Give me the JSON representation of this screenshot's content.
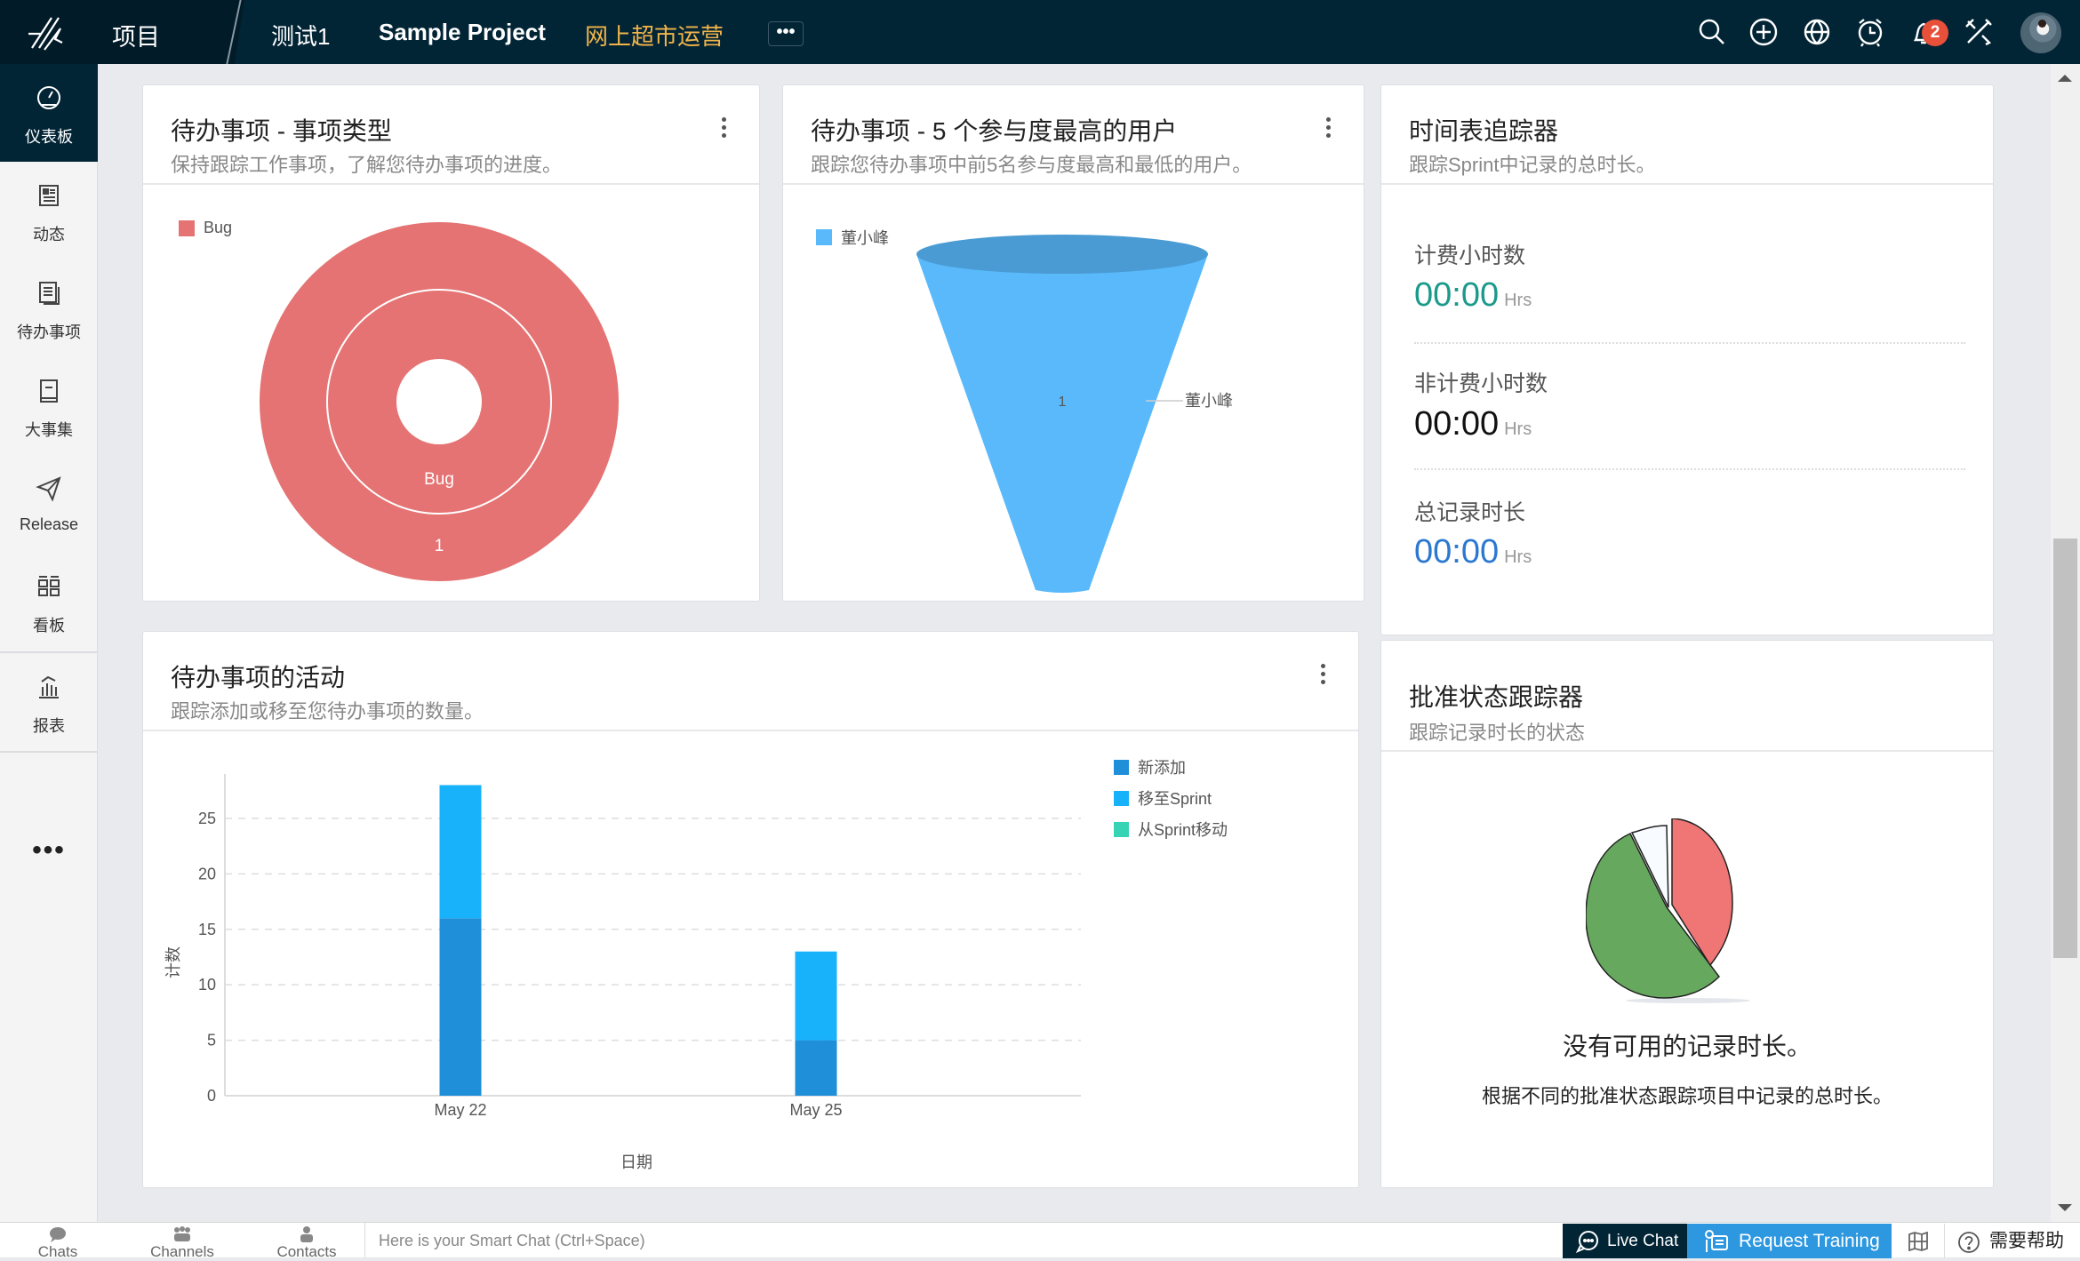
{
  "topbar": {
    "projects_label": "项目",
    "breadcrumbs": [
      "测试1",
      "Sample Project",
      "网上超市运营"
    ],
    "more_label": "•••",
    "notification_count": "2",
    "icons": [
      "search-icon",
      "add-icon",
      "globe-icon",
      "alarm-icon",
      "bell-icon",
      "tools-icon",
      "avatar"
    ]
  },
  "sidebar": {
    "items": [
      {
        "label": "仪表板",
        "icon": "dashboard-icon",
        "active": true
      },
      {
        "label": "动态",
        "icon": "feed-icon"
      },
      {
        "label": "待办事项",
        "icon": "backlog-icon"
      },
      {
        "label": "大事集",
        "icon": "epic-icon"
      },
      {
        "label": "Release",
        "icon": "release-icon"
      },
      {
        "label": "看板",
        "icon": "board-icon"
      },
      {
        "label": "报表",
        "icon": "reports-icon"
      }
    ],
    "more_label": "•••"
  },
  "cards": {
    "item_type": {
      "title": "待办事项 - 事项类型",
      "subtitle": "保持跟踪工作事项，了解您待办事项的进度。",
      "legend": "Bug",
      "inner_label": "Bug",
      "outer_label": "1"
    },
    "top_users": {
      "title": "待办事项 - 5 个参与度最高的用户",
      "subtitle": "跟踪您待办事项中前5名参与度最高和最低的用户。",
      "legend": "董小峰",
      "value_label": "1",
      "callout_label": "董小峰"
    },
    "timesheet": {
      "title": "时间表追踪器",
      "subtitle": "跟踪Sprint中记录的总时长。",
      "rows": [
        {
          "label": "计费小时数",
          "value": "00:00",
          "unit": "Hrs",
          "color": "#1a9a8a"
        },
        {
          "label": "非计费小时数",
          "value": "00:00",
          "unit": "Hrs",
          "color": "#111111"
        },
        {
          "label": "总记录时长",
          "value": "00:00",
          "unit": "Hrs",
          "color": "#2a78d0"
        }
      ]
    },
    "approval": {
      "title": "批准状态跟踪器",
      "subtitle": "跟踪记录时长的状态",
      "empty_title": "没有可用的记录时长。",
      "empty_desc": "根据不同的批准状态跟踪项目中记录的总时长。"
    },
    "activity": {
      "title": "待办事项的活动",
      "subtitle": "跟踪添加或移至您待办事项的数量。"
    }
  },
  "chart_data": [
    {
      "type": "pie",
      "title": "待办事项 - 事项类型",
      "categories": [
        "Bug"
      ],
      "values": [
        1
      ],
      "colors": [
        "#e57373"
      ],
      "legend_position": "top-left"
    },
    {
      "type": "funnel",
      "title": "待办事项 - 5 个参与度最高的用户",
      "categories": [
        "董小峰"
      ],
      "values": [
        1
      ],
      "colors": [
        "#59b9fb"
      ],
      "legend_position": "top-left"
    },
    {
      "type": "bar",
      "stacked": true,
      "title": "待办事项的活动",
      "categories": [
        "May 22",
        "May 25"
      ],
      "series": [
        {
          "name": "新添加",
          "values": [
            16,
            5
          ],
          "color": "#1e8fd8"
        },
        {
          "name": "移至Sprint",
          "values": [
            12,
            8
          ],
          "color": "#18b2fb"
        },
        {
          "name": "从Sprint移动",
          "values": [
            0,
            0
          ],
          "color": "#36d3b4"
        }
      ],
      "xlabel": "日期",
      "ylabel": "计数",
      "ylim": [
        0,
        29
      ],
      "yticks": [
        0,
        5,
        10,
        15,
        20,
        25
      ],
      "grid": true,
      "legend_position": "top-right"
    }
  ],
  "bottombar": {
    "tabs": [
      "Chats",
      "Channels",
      "Contacts"
    ],
    "search_placeholder": "Here is your Smart Chat (Ctrl+Space)",
    "live_chat": "Live Chat",
    "request_training": "Request Training",
    "help": "需要帮助"
  }
}
